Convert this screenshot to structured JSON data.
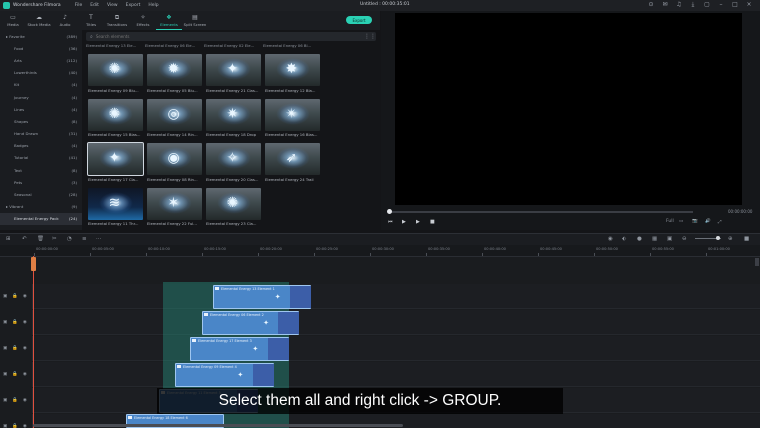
{
  "app": {
    "name": "Wondershare Filmora",
    "menu": [
      "File",
      "Edit",
      "View",
      "Export",
      "Help"
    ],
    "document_title": "Untitled : 00:00:35:01"
  },
  "toolbar": {
    "items": [
      {
        "label": "Media",
        "icon": "folder-icon"
      },
      {
        "label": "Stock Media",
        "icon": "cloud-icon"
      },
      {
        "label": "Audio",
        "icon": "music-icon"
      },
      {
        "label": "Titles",
        "icon": "text-icon"
      },
      {
        "label": "Transitions",
        "icon": "transition-icon"
      },
      {
        "label": "Effects",
        "icon": "sparkle-icon"
      },
      {
        "label": "Elements",
        "icon": "elements-icon",
        "active": true
      },
      {
        "label": "Split Screen",
        "icon": "split-screen-icon"
      }
    ],
    "export_label": "Export"
  },
  "sidebar": {
    "items": [
      {
        "name": "Favorite",
        "count": "(389)",
        "top": true
      },
      {
        "name": "Food",
        "count": "(36)"
      },
      {
        "name": "Arts",
        "count": "(112)"
      },
      {
        "name": "Lowerthirds",
        "count": "(40)"
      },
      {
        "name": "Kit",
        "count": "(4)"
      },
      {
        "name": "Journey",
        "count": "(4)"
      },
      {
        "name": "Lines",
        "count": "(4)"
      },
      {
        "name": "Shapes",
        "count": "(8)"
      },
      {
        "name": "Hand Drawn",
        "count": "(31)"
      },
      {
        "name": "Badges",
        "count": "(4)"
      },
      {
        "name": "Tutorial",
        "count": "(41)"
      },
      {
        "name": "Text",
        "count": "(8)"
      },
      {
        "name": "Pets",
        "count": "(3)"
      },
      {
        "name": "Seasonal",
        "count": "(28)"
      },
      {
        "name": "Vibrant",
        "count": "(9)",
        "top": true
      },
      {
        "name": "Elemental Energy Pack",
        "count": "(24)",
        "selected": true
      }
    ]
  },
  "search": {
    "placeholder": "Search elements"
  },
  "grid": {
    "row0_labels": [
      "Elemental Energy 13 Ele...",
      "Elemental Energy 06 Ele...",
      "Elemental Energy 02 Ele...",
      "Elemental Energy 06 Bl..."
    ],
    "items": [
      {
        "name": "Elemental Energy 09 Blu...",
        "glyph": "✺"
      },
      {
        "name": "Elemental Energy 05 Blu...",
        "glyph": "✹"
      },
      {
        "name": "Elemental Energy 21 Clas...",
        "glyph": "✦"
      },
      {
        "name": "Elemental Energy 12 Bla...",
        "glyph": "✸"
      },
      {
        "name": "Elemental Energy 15 Blas...",
        "glyph": "✺"
      },
      {
        "name": "Elemental Energy 14 Rin...",
        "glyph": "◎"
      },
      {
        "name": "Elemental Energy 18 Drop",
        "glyph": "✷"
      },
      {
        "name": "Elemental Energy 16 Blas...",
        "glyph": "✴"
      },
      {
        "name": "Elemental Energy 17 Cla...",
        "glyph": "✦",
        "selected": true
      },
      {
        "name": "Elemental Energy 08 Rin...",
        "glyph": "◉"
      },
      {
        "name": "Elemental Energy 20 Clas...",
        "glyph": "✧"
      },
      {
        "name": "Elemental Energy 24 Trail",
        "glyph": "➶"
      },
      {
        "name": "Elemental Energy 11 Thr...",
        "glyph": "≋",
        "blue": true
      },
      {
        "name": "Elemental Energy 22 Ful...",
        "glyph": "✶"
      },
      {
        "name": "Elemental Energy 23 Cla...",
        "glyph": "✺"
      }
    ]
  },
  "preview": {
    "timecode": "00:00:00:00",
    "quality": "Full",
    "controls": [
      "⏮",
      "▶",
      "▶",
      "■"
    ],
    "right_icons": [
      "Full",
      "▭",
      "📷",
      "🔊",
      "⤢"
    ]
  },
  "timeline": {
    "ruler_labels": [
      "00:00:00:00",
      "00:00:05:00",
      "00:00:10:00",
      "00:00:15:00",
      "00:00:20:00",
      "00:00:25:00",
      "00:00:30:00",
      "00:00:35:00",
      "00:00:40:00",
      "00:00:45:00",
      "00:00:50:00",
      "00:00:55:00",
      "00:01:00:00"
    ],
    "track_label": "6",
    "clips": [
      {
        "label": "Elemental Energy 13 Element 1"
      },
      {
        "label": "Elemental Energy 06 Element 2"
      },
      {
        "label": "Elemental Energy 17 Element 3"
      },
      {
        "label": "Elemental Energy 09 Element 4"
      },
      {
        "label": "Elemental Energy 11 Element 5"
      },
      {
        "label": "Elemental Energy 18 Element 6"
      }
    ]
  },
  "subtitle": "Select them all and right click -> GROUP."
}
